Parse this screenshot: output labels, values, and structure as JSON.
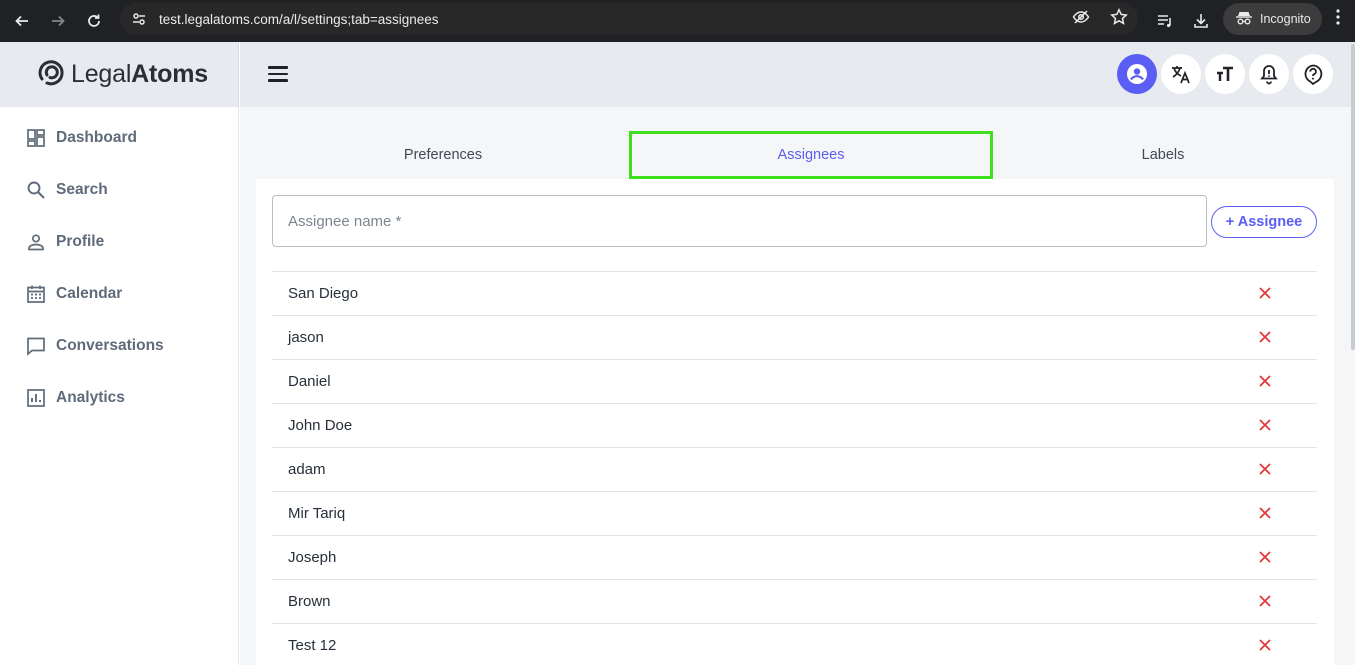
{
  "browser": {
    "url": "test.legalatoms.com/a/l/settings;tab=assignees",
    "incognito_label": "Incognito"
  },
  "app": {
    "logo": {
      "light": "Legal",
      "bold": "Atoms"
    }
  },
  "sidebar": {
    "items": [
      {
        "label": "Dashboard",
        "icon": "dashboard-icon"
      },
      {
        "label": "Search",
        "icon": "search-icon"
      },
      {
        "label": "Profile",
        "icon": "person-icon"
      },
      {
        "label": "Calendar",
        "icon": "calendar-icon"
      },
      {
        "label": "Conversations",
        "icon": "chat-icon"
      },
      {
        "label": "Analytics",
        "icon": "analytics-icon"
      }
    ]
  },
  "tabs": [
    {
      "label": "Preferences",
      "selected": false
    },
    {
      "label": "Assignees",
      "selected": true
    },
    {
      "label": "Labels",
      "selected": false
    }
  ],
  "assignee_form": {
    "placeholder": "Assignee name *",
    "add_label": "+ Assignee"
  },
  "assignees": [
    "San Diego",
    "jason",
    "Daniel",
    "John Doe",
    "adam",
    "Mir Tariq",
    "Joseph",
    "Brown",
    "Test 12"
  ],
  "colors": {
    "accent": "#5b5ef4",
    "highlight": "#3ee01e",
    "delete": "#e53935"
  }
}
